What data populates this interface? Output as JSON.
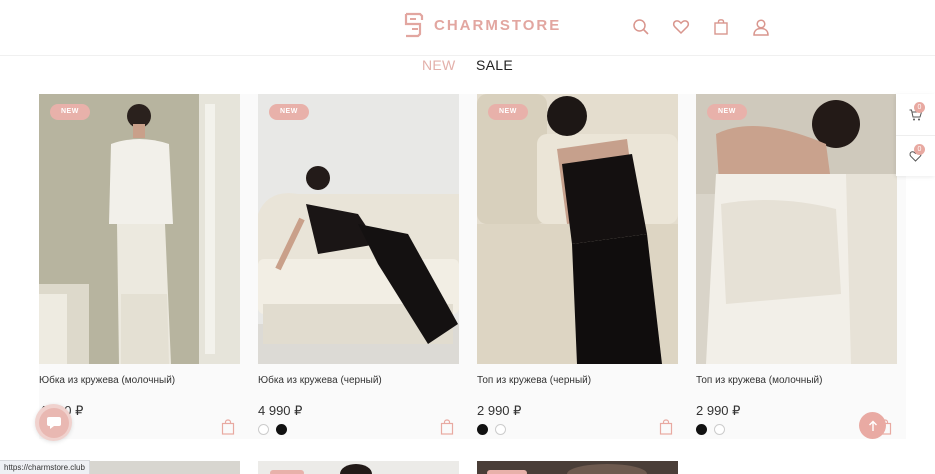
{
  "header": {
    "logo_text": "CHARMSTORE",
    "icons": [
      "search-icon",
      "heart-icon",
      "shopping-bag-icon",
      "user-icon"
    ]
  },
  "nav": {
    "new_label": "NEW",
    "sale_label": "SALE"
  },
  "side_panel": {
    "cart_count": "0",
    "wishlist_count": "0"
  },
  "products": [
    {
      "badge": "NEW",
      "name": "Юбка из кружева (молочный)",
      "price": "4 990 ₽",
      "swatches": []
    },
    {
      "badge": "NEW",
      "name": "Юбка из кружева (черный)",
      "price": "4 990 ₽",
      "swatches": [
        "white",
        "black"
      ]
    },
    {
      "badge": "NEW",
      "name": "Топ из кружева (черный)",
      "price": "2 990 ₽",
      "swatches": [
        "black",
        "white"
      ]
    },
    {
      "badge": "NEW",
      "name": "Топ из кружева (молочный)",
      "price": "2 990 ₽",
      "swatches": [
        "black",
        "white"
      ]
    }
  ],
  "status_bar": {
    "url": "https://charmstore.club"
  },
  "colors": {
    "accent": "#e8a9a1",
    "text": "#333333"
  }
}
